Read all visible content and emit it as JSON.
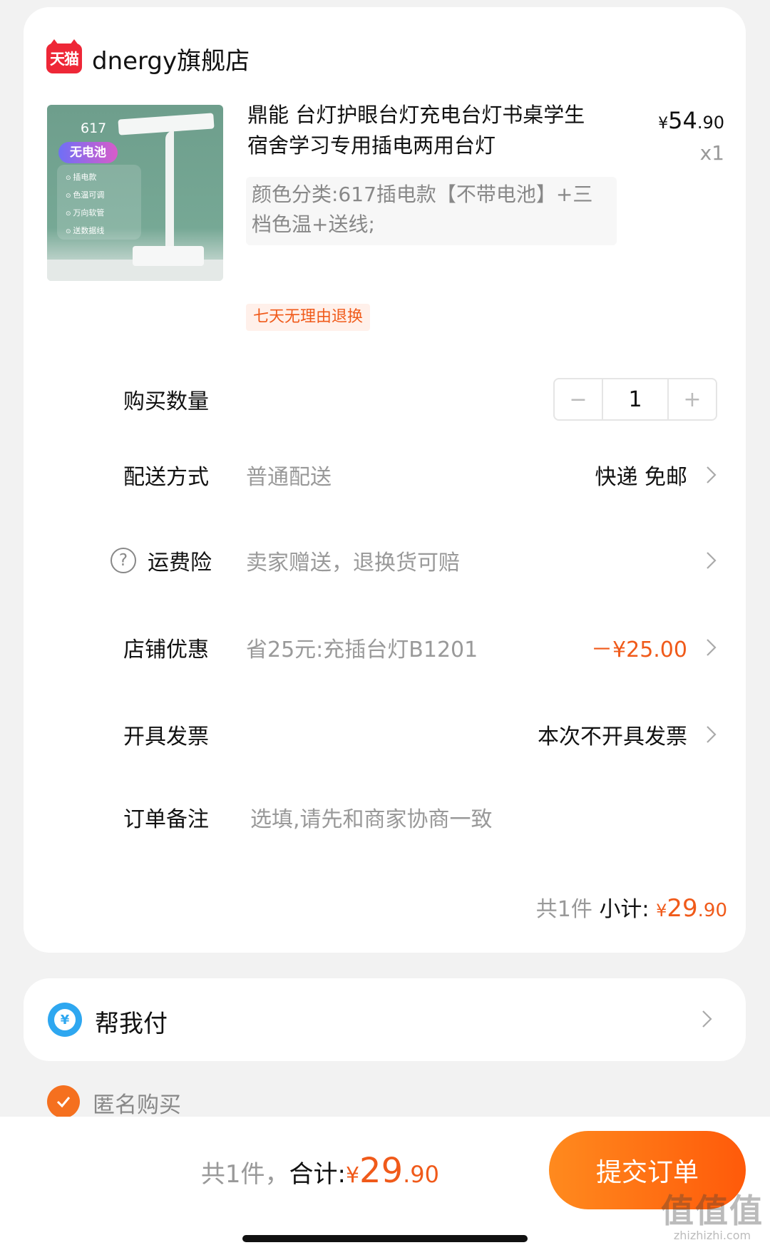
{
  "store": {
    "logo_text": "天猫",
    "name": "dnergy旗舰店"
  },
  "product": {
    "thumb": {
      "model": "617",
      "pill": "无电池",
      "features": [
        "插电款",
        "色温可调",
        "万向软管",
        "送数据线"
      ]
    },
    "title": "鼎能 台灯护眼台灯充电台灯书桌学生宿舍学习专用插电两用台灯",
    "sku": "颜色分类:617插电款【不带电池】+三档色温+送线;",
    "price": {
      "currency": "¥",
      "integer": "54",
      "cents": ".90"
    },
    "quantity_mult": "x1",
    "return_badge": "七天无理由退换"
  },
  "rows": {
    "quantity": {
      "label": "购买数量",
      "minus": "−",
      "value": "1",
      "plus": "+"
    },
    "delivery": {
      "label": "配送方式",
      "sub": "普通配送",
      "value": "快递 免邮"
    },
    "insurance": {
      "icon": "?",
      "label": "运费险",
      "sub": "卖家赠送，退换货可赔"
    },
    "discount": {
      "label": "店铺优惠",
      "sub": "省25元:充插台灯B1201",
      "value": "－¥25.00"
    },
    "invoice": {
      "label": "开具发票",
      "value": "本次不开具发票"
    },
    "note": {
      "label": "订单备注",
      "placeholder": "选填,请先和商家协商一致"
    }
  },
  "subtotal": {
    "count": "共1件",
    "label": "小计:",
    "currency": "¥",
    "integer": "29",
    "cents": ".90"
  },
  "help_pay": {
    "icon": "¥",
    "label": "帮我付"
  },
  "anonymous": {
    "label": "匿名购买",
    "checked": true
  },
  "footer": {
    "count": "共1件，",
    "label": "合计:",
    "currency": "¥",
    "integer": "29",
    "cents": ".90",
    "submit": "提交订单"
  },
  "watermark": {
    "main": "值值值",
    "sub": "zhizhizhi.com"
  },
  "colors": {
    "accent": "#f05a1a",
    "button": "#ff6a12",
    "brand_red": "#ee2737",
    "pay_blue": "#2ea7f0"
  }
}
